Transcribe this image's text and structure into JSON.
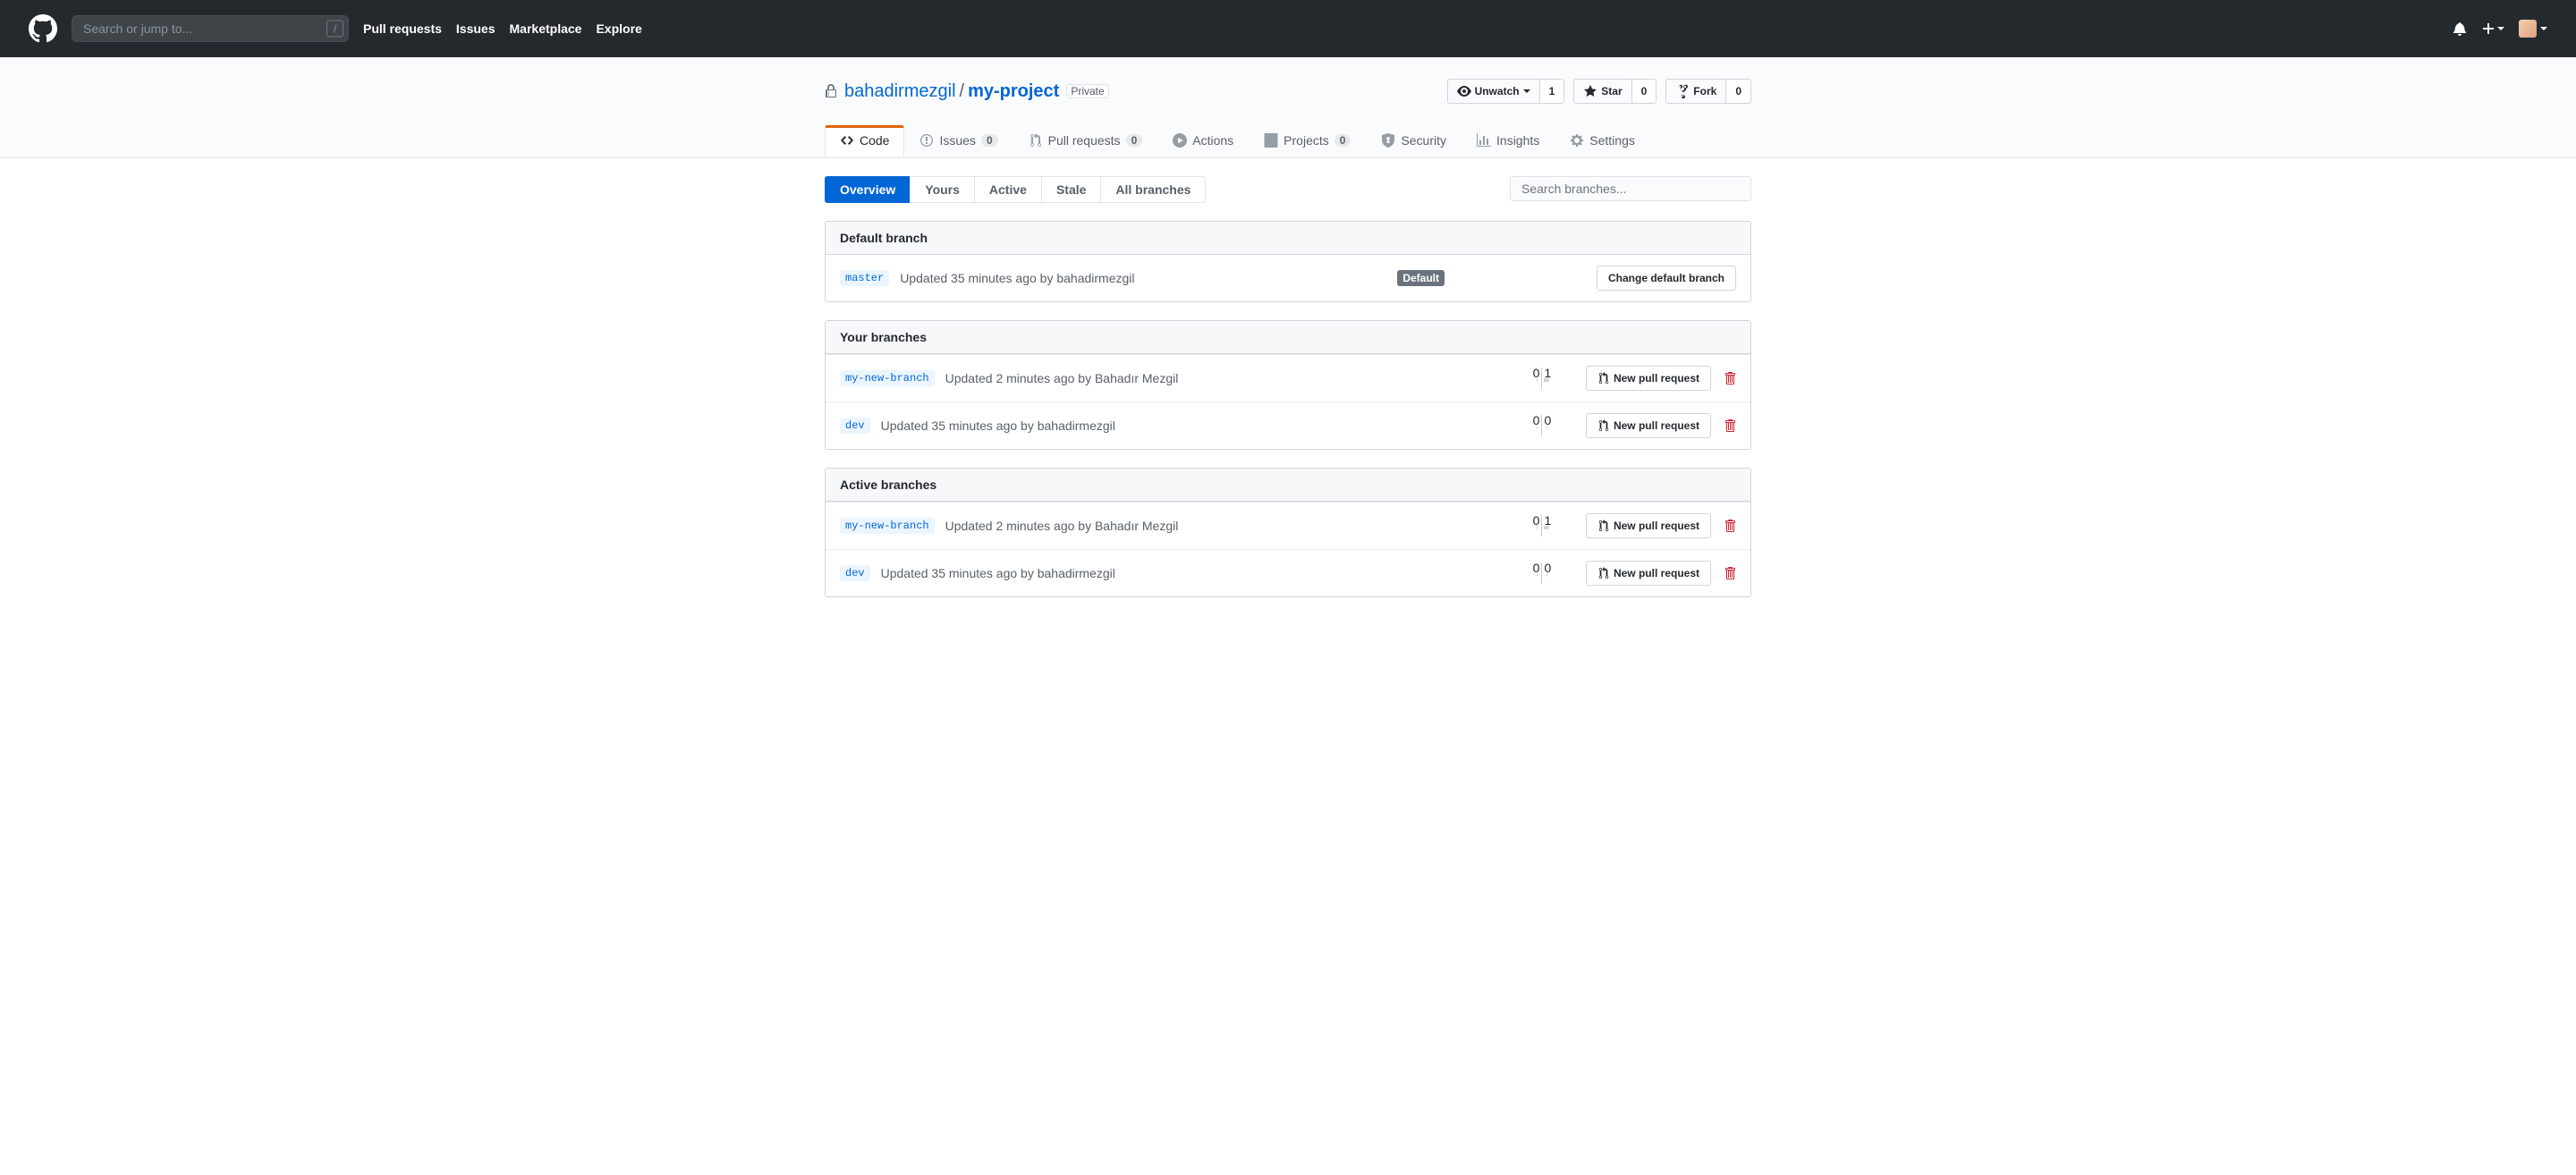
{
  "header": {
    "search_placeholder": "Search or jump to...",
    "slash": "/",
    "nav": {
      "pulls": "Pull requests",
      "issues": "Issues",
      "marketplace": "Marketplace",
      "explore": "Explore"
    }
  },
  "repo": {
    "owner": "bahadirmezgil",
    "name": "my-project",
    "privacy": "Private",
    "watch": {
      "label": "Unwatch",
      "count": "1"
    },
    "star": {
      "label": "Star",
      "count": "0"
    },
    "fork": {
      "label": "Fork",
      "count": "0"
    }
  },
  "reponav": {
    "code": "Code",
    "issues": "Issues",
    "issues_count": "0",
    "pulls": "Pull requests",
    "pulls_count": "0",
    "actions": "Actions",
    "projects": "Projects",
    "projects_count": "0",
    "security": "Security",
    "insights": "Insights",
    "settings": "Settings"
  },
  "subnav": {
    "overview": "Overview",
    "yours": "Yours",
    "active": "Active",
    "stale": "Stale",
    "all": "All branches",
    "search_placeholder": "Search branches..."
  },
  "sections": {
    "default": {
      "title": "Default branch",
      "branch": "master",
      "meta": "Updated 35 minutes ago by bahadirmezgil",
      "badge": "Default",
      "change_btn": "Change default branch"
    },
    "yours": {
      "title": "Your branches",
      "rows": [
        {
          "branch": "my-new-branch",
          "meta": "Updated 2 minutes ago by Bahadır Mezgil",
          "behind": "0",
          "ahead": "1",
          "btn": "New pull request"
        },
        {
          "branch": "dev",
          "meta": "Updated 35 minutes ago by bahadirmezgil",
          "behind": "0",
          "ahead": "0",
          "btn": "New pull request"
        }
      ]
    },
    "active": {
      "title": "Active branches",
      "rows": [
        {
          "branch": "my-new-branch",
          "meta": "Updated 2 minutes ago by Bahadır Mezgil",
          "behind": "0",
          "ahead": "1",
          "btn": "New pull request"
        },
        {
          "branch": "dev",
          "meta": "Updated 35 minutes ago by bahadirmezgil",
          "behind": "0",
          "ahead": "0",
          "btn": "New pull request"
        }
      ]
    }
  }
}
